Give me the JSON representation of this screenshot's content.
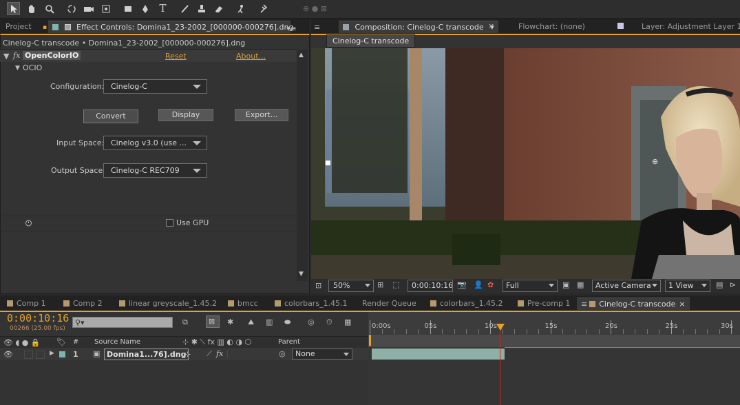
{
  "toolbar": {
    "tools": [
      "selection-tool-icon",
      "hand-tool-icon",
      "zoom-tool-icon",
      "rotation-tool-icon",
      "camera-tool-icon",
      "pan-behind-tool-icon",
      "rectangle-tool-icon",
      "pen-tool-icon",
      "type-tool-icon",
      "brush-tool-icon",
      "clone-stamp-tool-icon",
      "eraser-tool-icon",
      "roto-brush-tool-icon",
      "puppet-pin-tool-icon"
    ],
    "type_glyph": "T"
  },
  "left_panel": {
    "tab_project": "Project",
    "tab_effect": "Effect Controls: Domina1_23-2002_[000000-000276].dng",
    "breadcrumb": "Cinelog-C transcode • Domina1_23-2002_[000000-000276].dng",
    "fx_label": "fx",
    "effect_name": "OpenColorIO",
    "reset": "Reset",
    "about": "About...",
    "group": "OCIO",
    "config_label": "Configuration:",
    "config_value": "Cinelog-C",
    "btn_convert": "Convert",
    "btn_display": "Display",
    "btn_export": "Export...",
    "input_label": "Input Space:",
    "input_value": "Cinelog v3.0 (use ...",
    "output_label": "Output Space:",
    "output_value": "Cinelog-C REC709",
    "gpu_label": "Use GPU"
  },
  "comp_panel": {
    "tab_comp": "Composition: Cinelog-C transcode",
    "tab_flowchart": "Flowchart: (none)",
    "tab_layer": "Layer: Adjustment Layer 1",
    "comp_name_tab": "Cinelog-C transcode",
    "zoom": "50%",
    "timecode": "0:00:10:16",
    "resolution": "Full",
    "camera": "Active Camera",
    "views": "1 View"
  },
  "timeline_tabs": [
    {
      "label": "Comp 1",
      "color": "#b59a70"
    },
    {
      "label": "Comp 2",
      "color": "#b59a70"
    },
    {
      "label": "linear greyscale_1.45.2",
      "color": "#b59a70"
    },
    {
      "label": "bmcc",
      "color": "#b59a70"
    },
    {
      "label": "colorbars_1.45.1",
      "color": "#b59a70"
    },
    {
      "label": "Render Queue",
      "color": ""
    },
    {
      "label": "colorbars_1.45.2",
      "color": "#b59a70"
    },
    {
      "label": "Pre-comp 1",
      "color": "#b59a70"
    },
    {
      "label": "Cinelog-C transcode",
      "color": "#b59a70"
    }
  ],
  "timeline": {
    "current_time": "0:00:10:16",
    "frame_info": "00266 (25.00 fps)",
    "col_hash": "#",
    "col_source": "Source Name",
    "col_parent": "Parent",
    "layer_number": "1",
    "layer_name": "Domina1...76].dng",
    "layer_fx": "fx",
    "parent_value": "None",
    "ruler": [
      "0:00s",
      "05s",
      "10s",
      "15s",
      "20s",
      "25s",
      "30s"
    ]
  },
  "colors": {
    "accent_orange": "#e6a22a",
    "playhead_red": "#d02020",
    "layer_bar": "#8fb0a6",
    "tab_swatch": "#b59a70"
  }
}
